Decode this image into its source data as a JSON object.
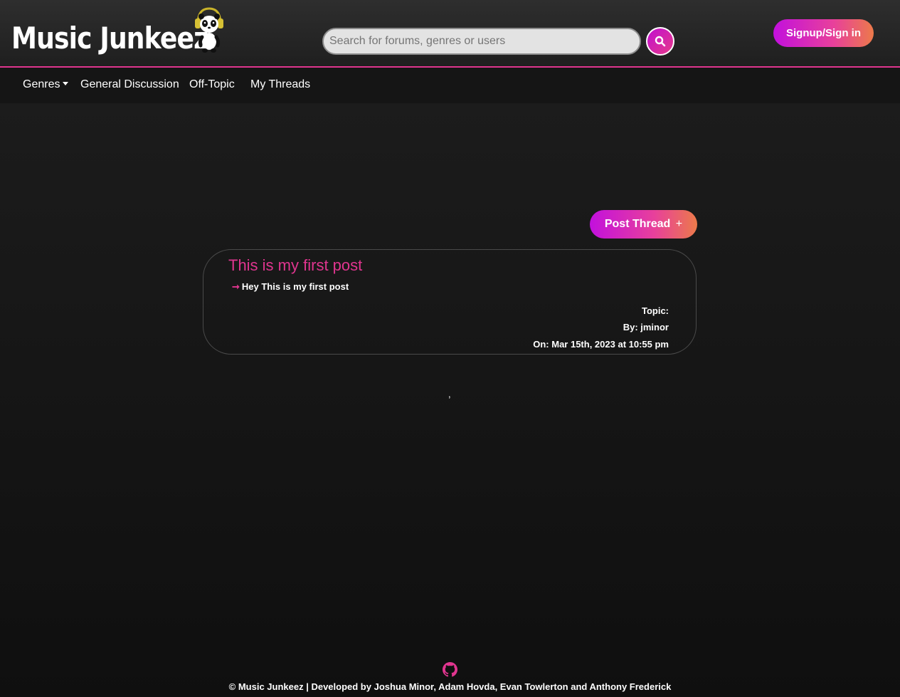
{
  "header": {
    "logo_text": "Music Junkeez",
    "search_placeholder": "Search for forums, genres or users",
    "search_value": "",
    "signup_label": "Signup/Sign in"
  },
  "nav": {
    "items": [
      {
        "label": "Genres",
        "dropdown": true
      },
      {
        "label": "General Discussion"
      },
      {
        "label": "Off-Topic"
      },
      {
        "label": "My Threads"
      }
    ]
  },
  "main": {
    "post_thread_label": "Post Thread",
    "post_thread_icon": "+",
    "posts": [
      {
        "title": "This is my first post",
        "body": "Hey This is my first post",
        "topic": "Topic:",
        "by": "By: jminor",
        "on": "On: Mar 15th, 2023 at 10:55 pm"
      }
    ],
    "stray_text": ","
  },
  "footer": {
    "text": "© Music Junkeez | Developed by Joshua Minor, Adam Hovda, Evan Towlerton and Anthony Frederick"
  },
  "colors": {
    "accent": "#e0358f",
    "gradient_start": "#c210dd",
    "gradient_end": "#ec7a4a",
    "background_dark": "#151515"
  },
  "icons": {
    "search": "search-icon",
    "github": "github-icon",
    "arrow": "arrow-right-icon",
    "logo_mascot": "panda-headphones-icon"
  }
}
